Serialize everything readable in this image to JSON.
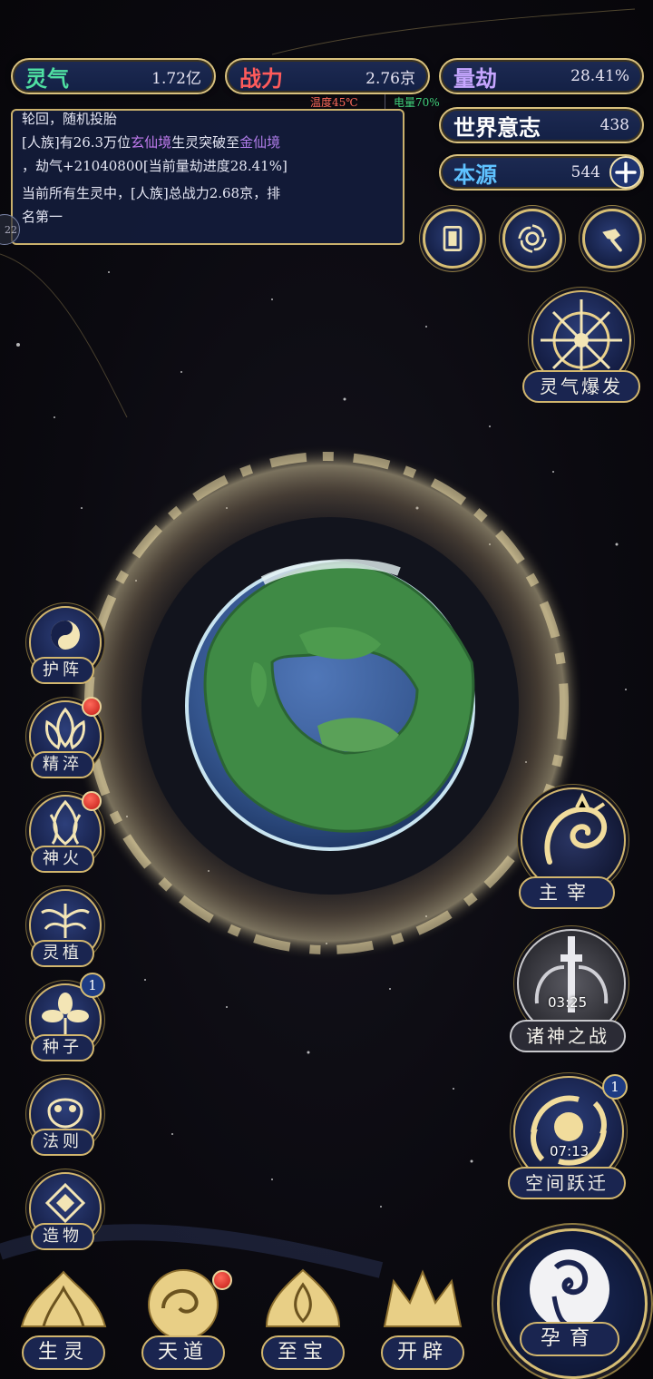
{
  "stats": {
    "lingqi": {
      "label": "灵气",
      "value": "1.72亿",
      "color": "#4fe0a2"
    },
    "zhanli": {
      "label": "战力",
      "value": "2.76京",
      "color": "#ff5b5b"
    },
    "liangjie": {
      "label": "量劫",
      "value": "28.41%",
      "color": "#c6a6ff"
    },
    "shijie": {
      "label": "世界意志",
      "value": "438",
      "color": "#ffffff"
    },
    "benyuan": {
      "label": "本源",
      "value": "544",
      "color": "#5fc2ff"
    }
  },
  "sub_info": {
    "temperature": "温度45℃",
    "power": "电量70%"
  },
  "log": {
    "line1": "轮回，随机投胎",
    "line2_a": "[人族]有26.3万位",
    "line2_realm1": "玄仙境",
    "line2_b": "生灵突破至",
    "line2_realm2": "金仙境",
    "line3": "，劫气+21040800[当前量劫进度28.41%]",
    "line4": "当前所有生灵中，[人族]总战力2.68京，排",
    "line5": "名第一"
  },
  "edge_tab": "22",
  "top_icons": [
    "card-icon",
    "vortex-icon",
    "hammer-icon"
  ],
  "burst": {
    "label": "灵气爆发"
  },
  "left_menu": [
    {
      "label": "护阵",
      "badge": ""
    },
    {
      "label": "精淬",
      "badge": "dot"
    },
    {
      "label": "神火",
      "badge": "dot"
    },
    {
      "label": "灵植",
      "badge": ""
    },
    {
      "label": "种子",
      "badge": "1"
    },
    {
      "label": "法则",
      "badge": ""
    },
    {
      "label": "造物",
      "badge": ""
    }
  ],
  "right_features": {
    "master": {
      "label": "主宰"
    },
    "war": {
      "label": "诸神之战",
      "timer": "03:25"
    },
    "space": {
      "label": "空间跃迁",
      "timer": "07:13",
      "badge": "1"
    }
  },
  "bottom_nav": [
    {
      "label": "生灵"
    },
    {
      "label": "天道"
    },
    {
      "label": "至宝"
    },
    {
      "label": "开辟"
    }
  ],
  "nurture": {
    "label": "孕育"
  },
  "theme": {
    "gold": "#d6bd74",
    "panel": "#1a2550",
    "ocean": "#3b5fa0",
    "land": "#3f8a45"
  }
}
